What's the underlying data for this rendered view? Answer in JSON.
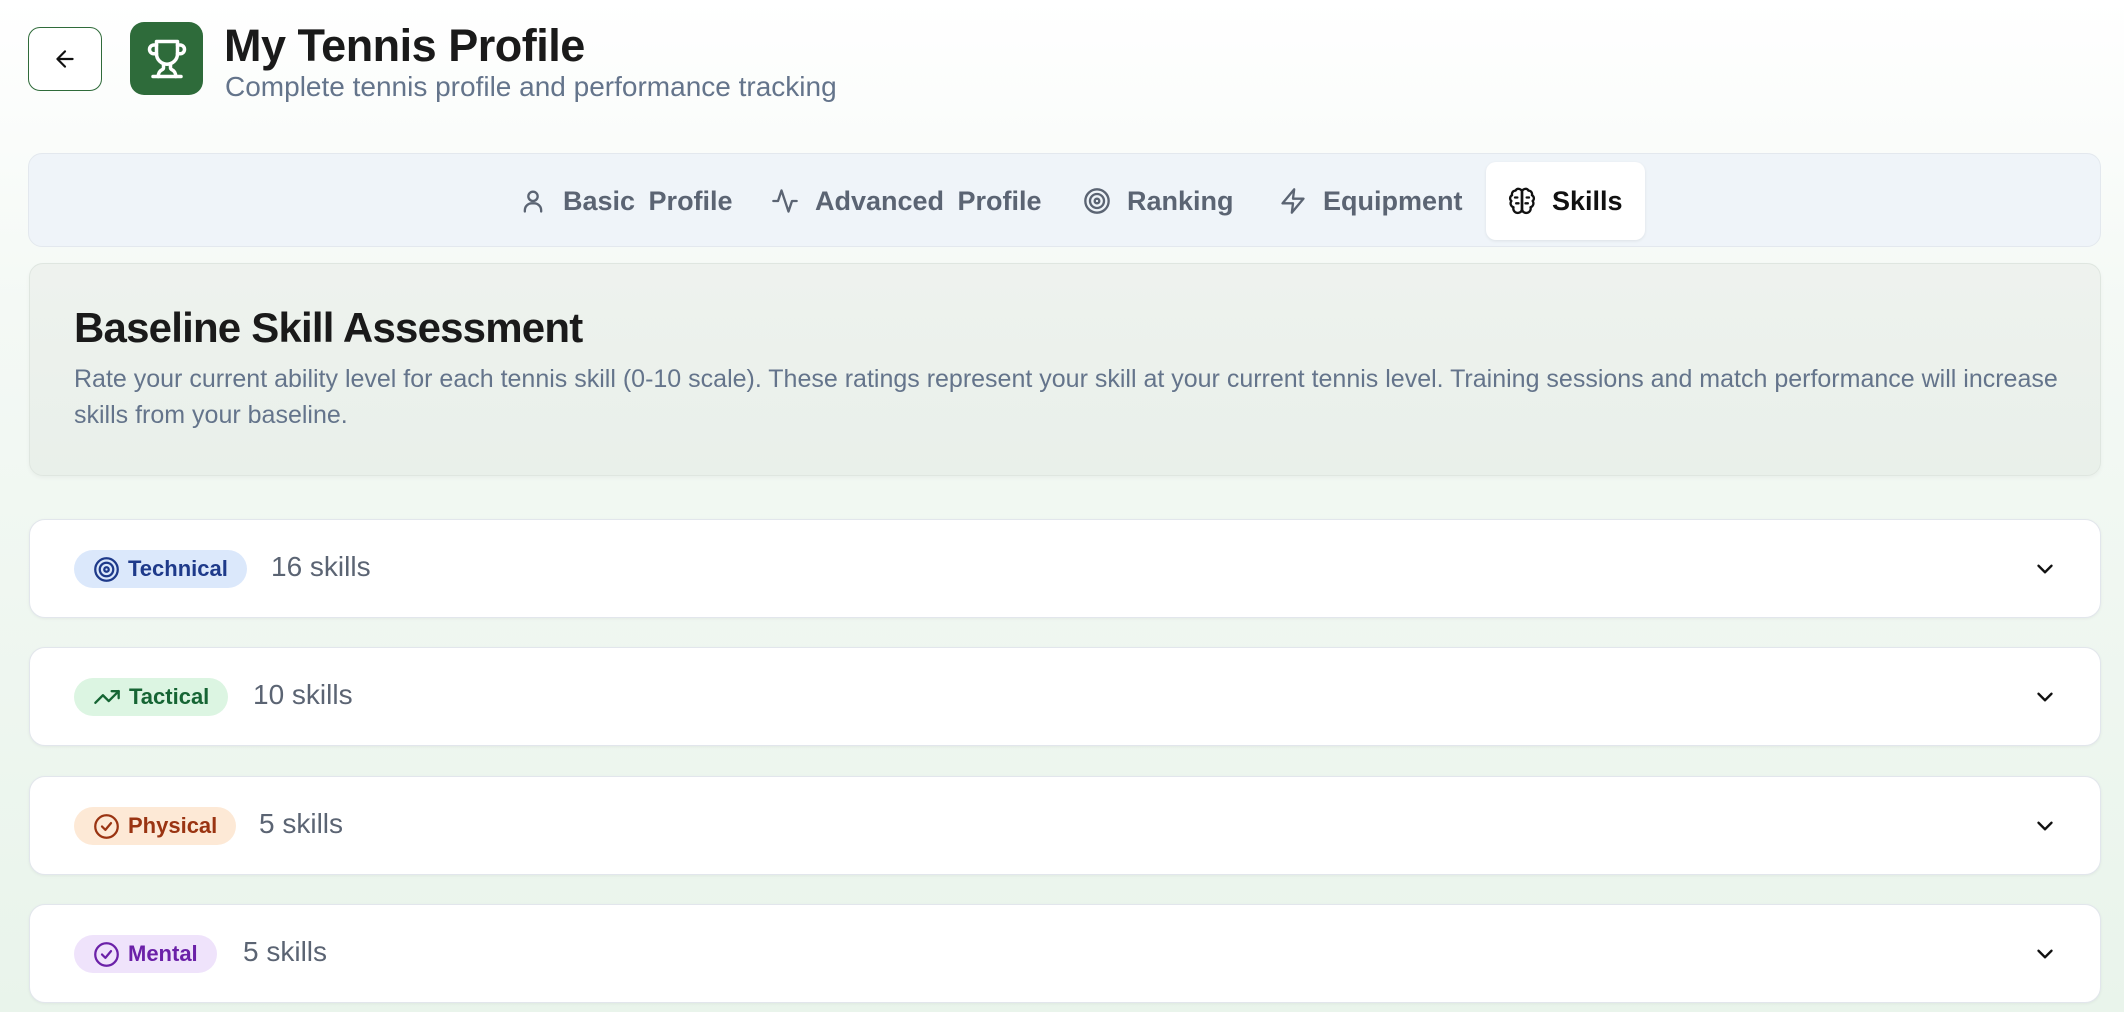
{
  "header": {
    "title": "My Tennis Profile",
    "subtitle": "Complete tennis profile and performance tracking",
    "icons": {
      "back": "arrow-left-icon",
      "app": "trophy-icon"
    }
  },
  "tabs": [
    {
      "label": "Basic Profile",
      "icon": "user-icon",
      "active": false
    },
    {
      "label": "Advanced Profile",
      "icon": "activity-icon",
      "active": false
    },
    {
      "label": "Ranking",
      "icon": "target-icon",
      "active": false
    },
    {
      "label": "Equipment",
      "icon": "lightning-icon",
      "active": false
    },
    {
      "label": "Skills",
      "icon": "brain-icon",
      "active": true
    }
  ],
  "assessment": {
    "title": "Baseline Skill Assessment",
    "description": "Rate your current ability level for each tennis skill (0-10 scale). These ratings represent your skill at your current tennis level. Training sessions and match performance will increase skills from your baseline."
  },
  "categories": [
    {
      "name": "Technical",
      "count": "16 skills",
      "icon": "target-icon",
      "bg": "#dbe8fb",
      "color": "#1e3a8a"
    },
    {
      "name": "Tactical",
      "count": "10 skills",
      "icon": "trending-up-icon",
      "bg": "#dcf5e2",
      "color": "#166534"
    },
    {
      "name": "Physical",
      "count": "5 skills",
      "icon": "check-circle-icon",
      "bg": "#fde9d6",
      "color": "#9a3412"
    },
    {
      "name": "Mental",
      "count": "5 skills",
      "icon": "check-circle-icon",
      "bg": "#efe3fb",
      "color": "#6b21a8"
    }
  ],
  "colors": {
    "brand": "#2e6b3a"
  }
}
